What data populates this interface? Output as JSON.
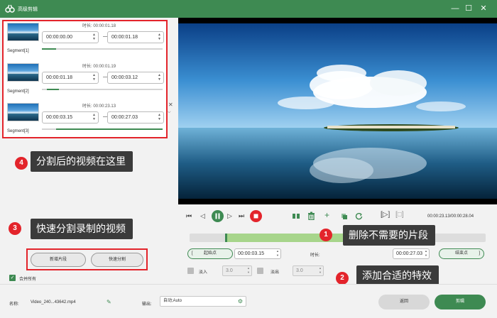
{
  "window": {
    "title": "高级剪辑",
    "minimize": "—",
    "maximize": "☐",
    "close": "✕"
  },
  "colors": {
    "accent": "#3e8a52",
    "annotation": "#e3242b",
    "callout_bg": "#3b3b3b"
  },
  "segments": [
    {
      "label": "Segment[1]",
      "duration_label": "时长: 00:00:01.18",
      "start": "00:00:00.00",
      "end": "00:00:01.18",
      "fill_start": 0.0,
      "fill_end": 0.12
    },
    {
      "label": "Segment[2]",
      "duration_label": "时长: 00:00:01.19",
      "start": "00:00:01.18",
      "end": "00:00:03.12",
      "fill_start": 0.04,
      "fill_end": 0.14
    },
    {
      "label": "Segment[3]",
      "duration_label": "时长: 00:00:23.13",
      "start": "00:00:03.15",
      "end": "00:00:27.03",
      "fill_start": 0.12,
      "fill_end": 1.0
    }
  ],
  "annotations": {
    "n1": "1",
    "t1": "删除不需要的片段",
    "n2": "2",
    "t2": "添加合适的特效",
    "n3": "3",
    "t3": "快速分割录制的视频",
    "n4": "4",
    "t4": "分割后的视频在这里"
  },
  "left_buttons": {
    "new_segment": "新增片段",
    "quick_split": "快速分割"
  },
  "merge": {
    "label": "合并所有",
    "checked": true
  },
  "player": {
    "time": "00:00:23.13/00:00:28.04",
    "icons": [
      "skip-start-icon",
      "step-back-icon",
      "pause-icon",
      "step-forward-icon",
      "skip-end-icon",
      "stop-icon",
      "split-icon",
      "delete-icon",
      "add-icon",
      "copy-icon",
      "rotate-icon",
      "frame-icon",
      "snapshot-icon"
    ],
    "selection_start_fraction": 0.12,
    "selection_end_fraction": 0.82
  },
  "trim": {
    "start_button": "起始点",
    "start_time": "00:00:03.15",
    "duration_label": "时长:",
    "end_time": "00:00:27.03",
    "end_button": "结束点"
  },
  "fade": {
    "fade_in_label": "淡入",
    "fade_in_value": "3.0",
    "fade_out_label": "淡出",
    "fade_out_value": "3.0"
  },
  "bottom": {
    "name_label": "名称:",
    "name_value": "Video_240...43642.mp4",
    "output_label": "输出:",
    "output_value": "自动;Auto",
    "back_button": "返回",
    "edit_button": "剪辑"
  }
}
